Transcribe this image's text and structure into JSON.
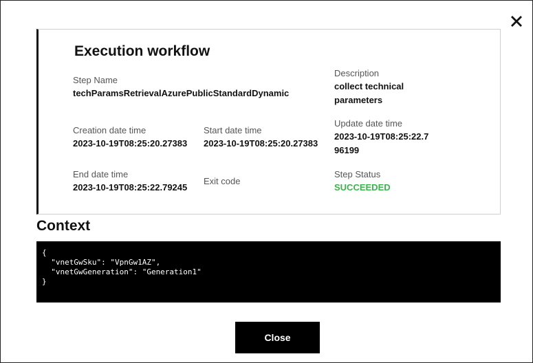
{
  "dialog": {
    "title": "Execution workflow",
    "close_icon": "close-icon",
    "close_button_label": "Close"
  },
  "fields": {
    "step_name": {
      "label": "Step Name",
      "value": "techParamsRetrievalAzurePublicStandardDynamic"
    },
    "description": {
      "label": "Description",
      "value": "collect technical parameters"
    },
    "creation_date_time": {
      "label": "Creation date time",
      "value": "2023-10-19T08:25:20.27383"
    },
    "start_date_time": {
      "label": "Start date time",
      "value": "2023-10-19T08:25:20.27383"
    },
    "update_date_time": {
      "label": "Update date time",
      "value": "2023-10-19T08:25:22.796199"
    },
    "end_date_time": {
      "label": "End date time",
      "value": "2023-10-19T08:25:22.79245"
    },
    "exit_code": {
      "label": "Exit code",
      "value": ""
    },
    "step_status": {
      "label": "Step Status",
      "value": "SUCCEEDED"
    }
  },
  "context": {
    "title": "Context",
    "json_text": "{\n  \"vnetGwSku\": \"VpnGw1AZ\",\n  \"vnetGwGeneration\": \"Generation1\"\n}"
  },
  "colors": {
    "status_success": "#3ab54a",
    "code_background": "#000000",
    "button_background": "#000000"
  }
}
